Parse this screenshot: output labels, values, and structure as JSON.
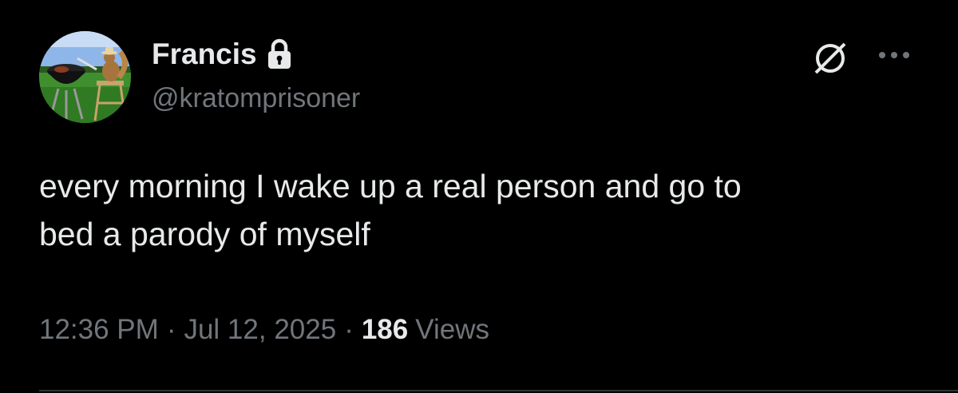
{
  "author": {
    "display_name": "Francis",
    "handle": "@kratomprisoner",
    "protected_icon": "lock-icon",
    "avatar_icon": "avatar"
  },
  "actions": {
    "grok_icon": "grok-icon",
    "more_icon": "more-icon"
  },
  "tweet": {
    "text": "every morning I wake up a real person and go to\nbed a parody of myself"
  },
  "meta": {
    "time": "12:36 PM",
    "separator": "·",
    "date": "Jul 12, 2025",
    "views_count": "186",
    "views_label": "Views"
  },
  "colors": {
    "background": "#000000",
    "primary_text": "#e7e9ea",
    "secondary_text": "#71767b",
    "divider": "#2f3336"
  }
}
